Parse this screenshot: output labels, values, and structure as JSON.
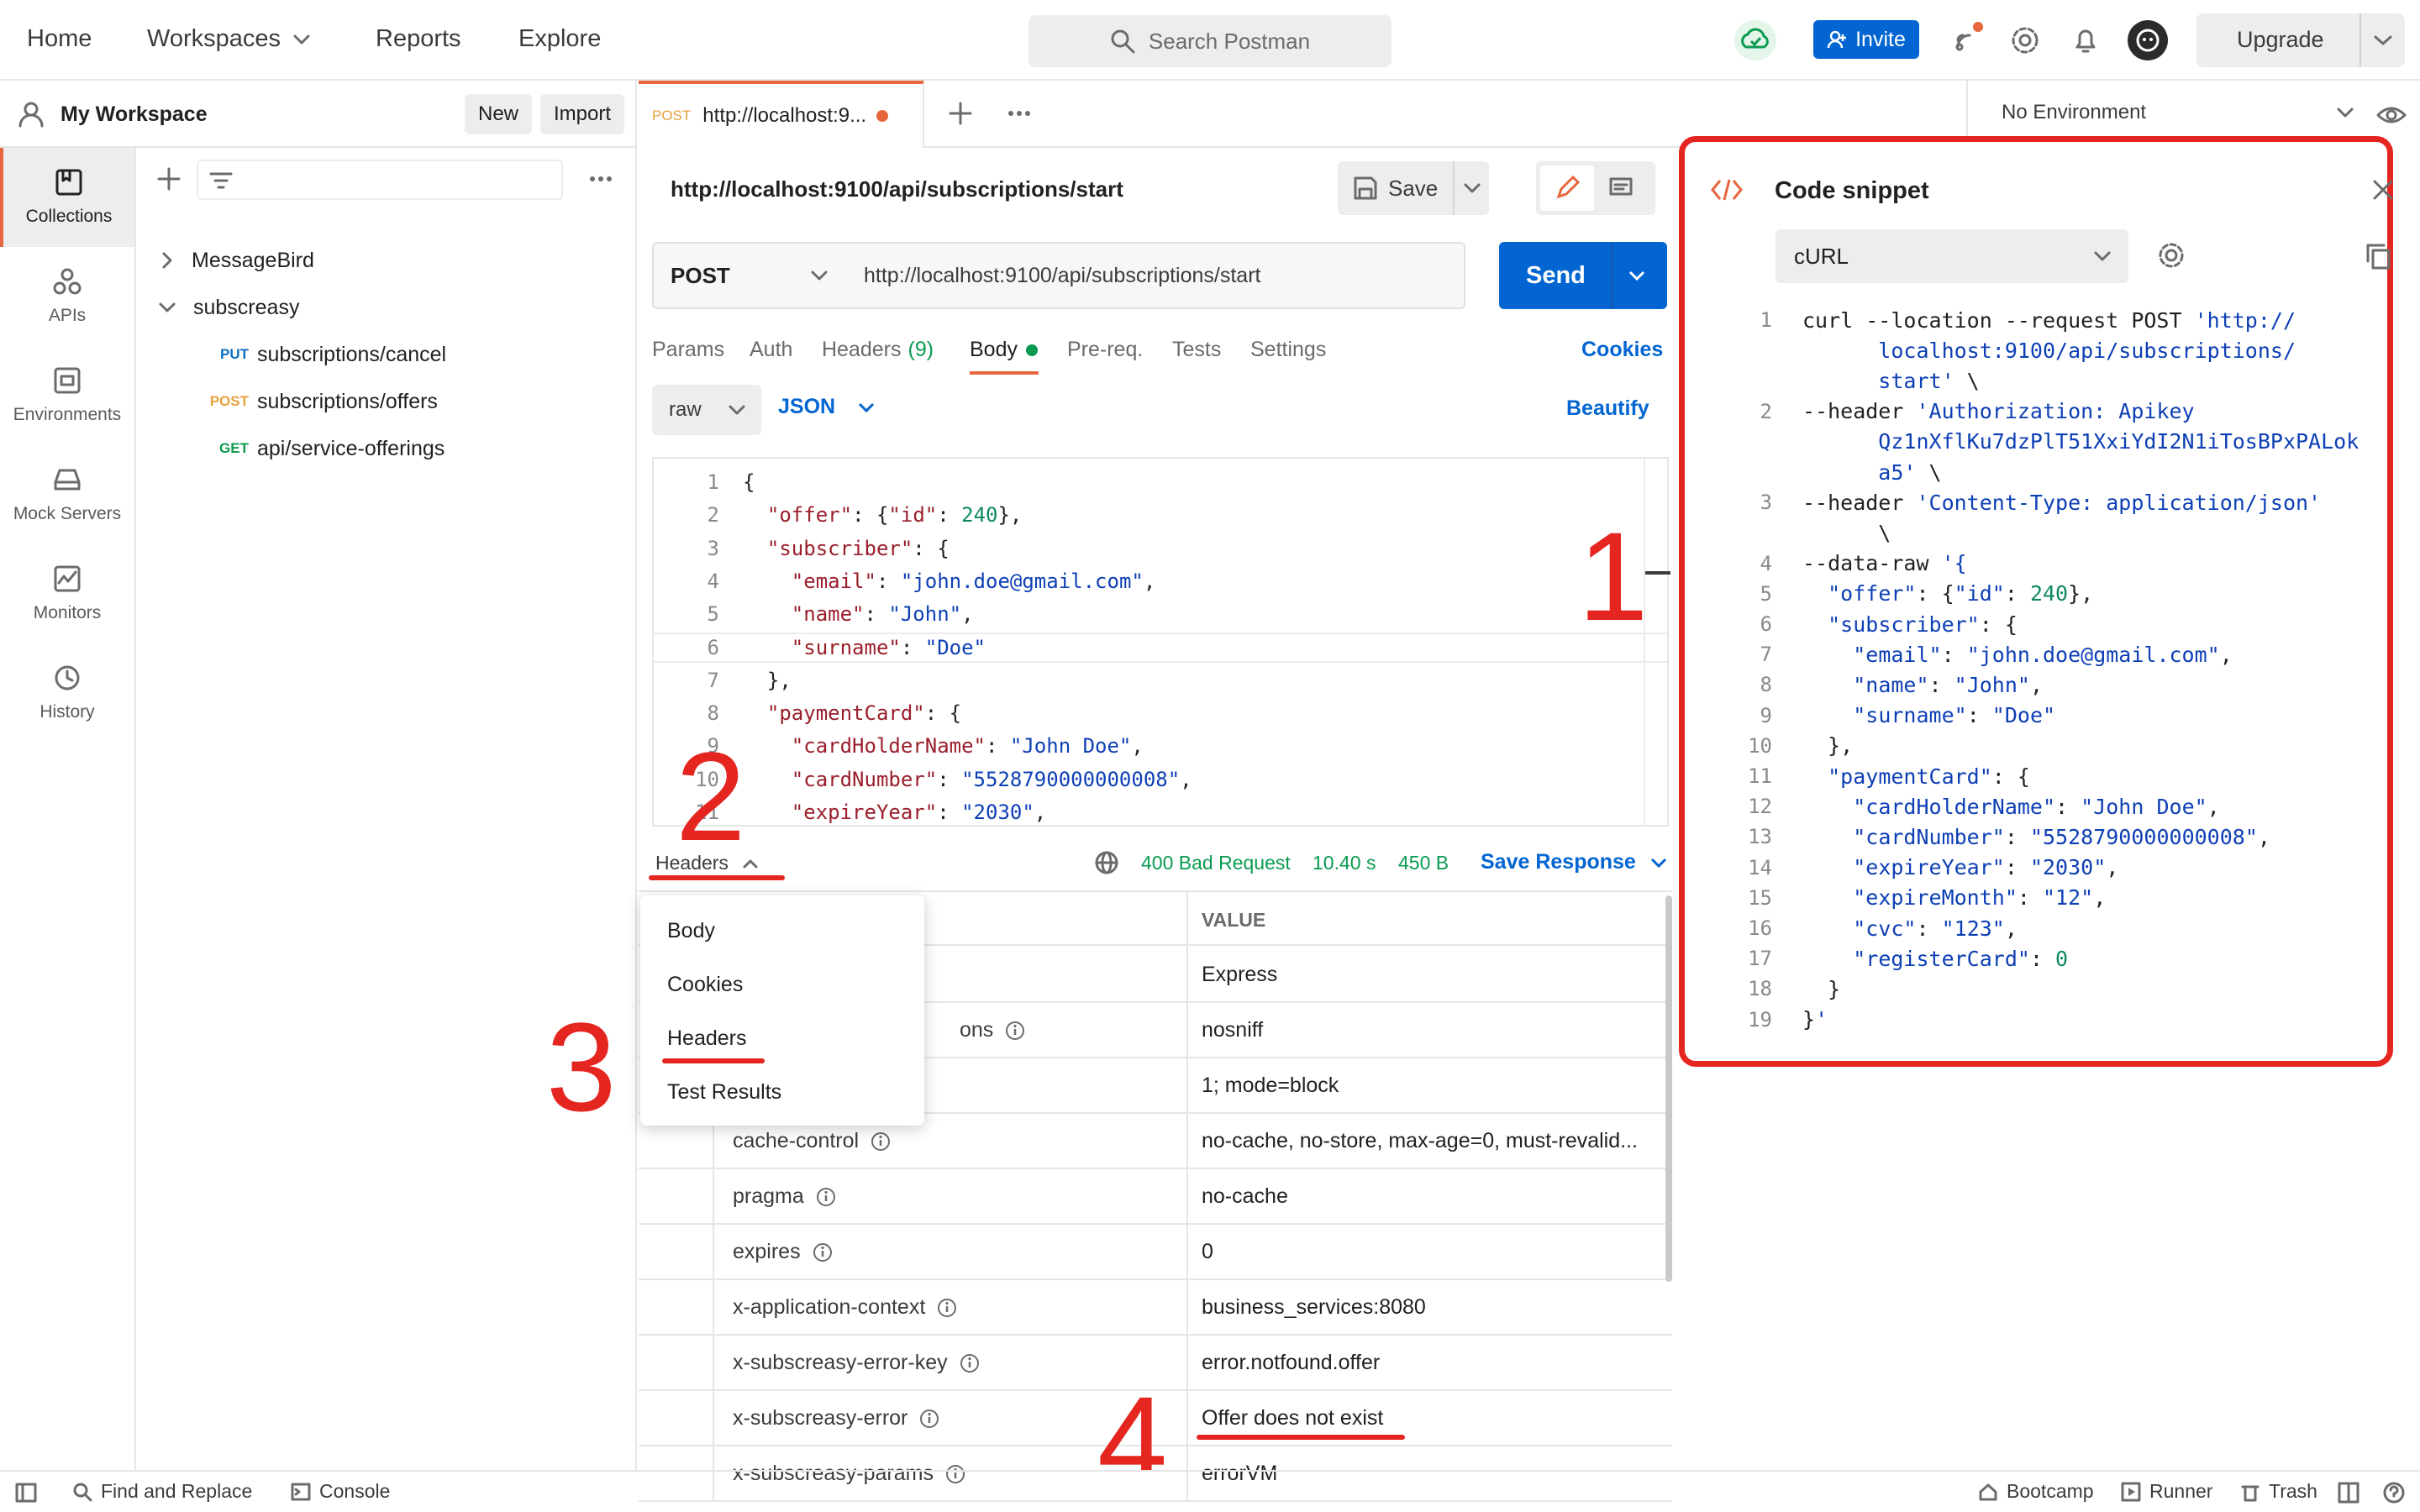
{
  "topnav": {
    "home": "Home",
    "workspaces": "Workspaces",
    "reports": "Reports",
    "explore": "Explore",
    "search_placeholder": "Search Postman",
    "invite": "Invite",
    "upgrade": "Upgrade"
  },
  "workspace": {
    "name": "My Workspace",
    "new": "New",
    "import": "Import"
  },
  "sidebar": [
    "Collections",
    "APIs",
    "Environments",
    "Mock Servers",
    "Monitors",
    "History"
  ],
  "tree": {
    "collections": [
      {
        "name": "MessageBird",
        "expanded": false
      },
      {
        "name": "subscreasy",
        "expanded": true
      }
    ],
    "requests": [
      {
        "method": "PUT",
        "path": "subscriptions/cancel",
        "color": "#0b6ec0"
      },
      {
        "method": "POST",
        "path": "subscriptions/offers",
        "color": "#e6a23c"
      },
      {
        "method": "GET",
        "path": "api/service-offerings",
        "color": "#0a9b50"
      }
    ]
  },
  "tab": {
    "method": "POST",
    "title": "http://localhost:9..."
  },
  "request": {
    "url_title": "http://localhost:9100/api/subscriptions/start",
    "save": "Save",
    "method": "POST",
    "url": "http://localhost:9100/api/subscriptions/start",
    "send": "Send",
    "tabs": {
      "params": "Params",
      "auth": "Auth",
      "headers": "Headers",
      "headers_count": "(9)",
      "body": "Body",
      "prereq": "Pre-req.",
      "tests": "Tests",
      "settings": "Settings"
    },
    "cookies": "Cookies",
    "body_mode": "raw",
    "body_lang": "JSON",
    "beautify": "Beautify"
  },
  "body_lines": [
    [
      [
        "p",
        "{"
      ]
    ],
    [
      [
        "p",
        "  "
      ],
      [
        "k",
        "\"offer\""
      ],
      [
        "p",
        ": {"
      ],
      [
        "k",
        "\"id\""
      ],
      [
        "p",
        ": "
      ],
      [
        "n",
        "240"
      ],
      [
        "p",
        "},"
      ]
    ],
    [
      [
        "p",
        "  "
      ],
      [
        "k",
        "\"subscriber\""
      ],
      [
        "p",
        ": {"
      ]
    ],
    [
      [
        "p",
        "    "
      ],
      [
        "k",
        "\"email\""
      ],
      [
        "p",
        ": "
      ],
      [
        "s",
        "\"john.doe@gmail.com\""
      ],
      [
        "p",
        ","
      ]
    ],
    [
      [
        "p",
        "    "
      ],
      [
        "k",
        "\"name\""
      ],
      [
        "p",
        ": "
      ],
      [
        "s",
        "\"John\""
      ],
      [
        "p",
        ","
      ]
    ],
    [
      [
        "p",
        "    "
      ],
      [
        "k",
        "\"surname\""
      ],
      [
        "p",
        ": "
      ],
      [
        "s",
        "\"Doe\""
      ]
    ],
    [
      [
        "p",
        "  },"
      ]
    ],
    [
      [
        "p",
        "  "
      ],
      [
        "k",
        "\"paymentCard\""
      ],
      [
        "p",
        ": {"
      ]
    ],
    [
      [
        "p",
        "    "
      ],
      [
        "k",
        "\"cardHolderName\""
      ],
      [
        "p",
        ": "
      ],
      [
        "s",
        "\"John Doe\""
      ],
      [
        "p",
        ","
      ]
    ],
    [
      [
        "p",
        "    "
      ],
      [
        "k",
        "\"cardNumber\""
      ],
      [
        "p",
        ": "
      ],
      [
        "s",
        "\"5528790000000008\""
      ],
      [
        "p",
        ","
      ]
    ],
    [
      [
        "p",
        "    "
      ],
      [
        "k",
        "\"expireYear\""
      ],
      [
        "p",
        ": "
      ],
      [
        "s",
        "\"2030\""
      ],
      [
        "p",
        ","
      ]
    ],
    [
      [
        "p",
        "    "
      ],
      [
        "k",
        "\"expireMonth\""
      ],
      [
        "p",
        ": "
      ],
      [
        "s",
        "\"12\""
      ],
      [
        "p",
        ","
      ]
    ]
  ],
  "response": {
    "view": "Headers",
    "status": "400 Bad Request",
    "time": "10.40 s",
    "size": "450 B",
    "save_response": "Save Response",
    "value_header": "VALUE"
  },
  "dropdown": [
    "Body",
    "Cookies",
    "Headers",
    "Test Results"
  ],
  "headers_rows": [
    {
      "key": "",
      "value": "Express"
    },
    {
      "key": "ons",
      "value": "nosniff"
    },
    {
      "key": "",
      "value": "1; mode=block"
    },
    {
      "key": "cache-control",
      "value": "no-cache, no-store, max-age=0, must-revalid..."
    },
    {
      "key": "pragma",
      "value": "no-cache"
    },
    {
      "key": "expires",
      "value": "0"
    },
    {
      "key": "x-application-context",
      "value": "business_services:8080"
    },
    {
      "key": "x-subscreasy-error-key",
      "value": "error.notfound.offer"
    },
    {
      "key": "x-subscreasy-error",
      "value": "Offer does not exist"
    },
    {
      "key": "x-subscreasy-params",
      "value": "errorVM"
    }
  ],
  "environment": "No Environment",
  "snippet": {
    "title": "Code snippet",
    "language": "cURL",
    "lines": [
      {
        "n": "1",
        "t": [
          [
            "p",
            "curl --location --request POST "
          ],
          [
            "s",
            "'http://"
          ]
        ]
      },
      {
        "n": "",
        "t": [
          [
            "s",
            "      localhost:9100/api/subscriptions/"
          ]
        ]
      },
      {
        "n": "",
        "t": [
          [
            "s",
            "      start'"
          ],
          [
            "p",
            " \\"
          ]
        ]
      },
      {
        "n": "2",
        "t": [
          [
            "p",
            "--header "
          ],
          [
            "s",
            "'Authorization: Apikey"
          ]
        ]
      },
      {
        "n": "",
        "t": [
          [
            "s",
            "      Qz1nXflKu7dzPlT51XxiYdI2N1iTosBPxPALok"
          ]
        ]
      },
      {
        "n": "",
        "t": [
          [
            "s",
            "      a5'"
          ],
          [
            "p",
            " \\"
          ]
        ]
      },
      {
        "n": "3",
        "t": [
          [
            "p",
            "--header "
          ],
          [
            "s",
            "'Content-Type: application/json'"
          ]
        ]
      },
      {
        "n": "",
        "t": [
          [
            "p",
            "      \\"
          ]
        ]
      },
      {
        "n": "4",
        "t": [
          [
            "p",
            "--data-raw "
          ],
          [
            "s",
            "'{"
          ]
        ]
      },
      {
        "n": "5",
        "t": [
          [
            "p",
            "  "
          ],
          [
            "s",
            "\"offer\""
          ],
          [
            "p",
            ": {"
          ],
          [
            "s",
            "\"id\""
          ],
          [
            "p",
            ": "
          ],
          [
            "n",
            "240"
          ],
          [
            "p",
            "},"
          ]
        ]
      },
      {
        "n": "6",
        "t": [
          [
            "p",
            "  "
          ],
          [
            "s",
            "\"subscriber\""
          ],
          [
            "p",
            ": {"
          ]
        ]
      },
      {
        "n": "7",
        "t": [
          [
            "p",
            "    "
          ],
          [
            "s",
            "\"email\""
          ],
          [
            "p",
            ": "
          ],
          [
            "s",
            "\"john.doe@gmail.com\""
          ],
          [
            "p",
            ","
          ]
        ]
      },
      {
        "n": "8",
        "t": [
          [
            "p",
            "    "
          ],
          [
            "s",
            "\"name\""
          ],
          [
            "p",
            ": "
          ],
          [
            "s",
            "\"John\""
          ],
          [
            "p",
            ","
          ]
        ]
      },
      {
        "n": "9",
        "t": [
          [
            "p",
            "    "
          ],
          [
            "s",
            "\"surname\""
          ],
          [
            "p",
            ": "
          ],
          [
            "s",
            "\"Doe\""
          ]
        ]
      },
      {
        "n": "10",
        "t": [
          [
            "p",
            "  },"
          ]
        ]
      },
      {
        "n": "11",
        "t": [
          [
            "p",
            "  "
          ],
          [
            "s",
            "\"paymentCard\""
          ],
          [
            "p",
            ": {"
          ]
        ]
      },
      {
        "n": "12",
        "t": [
          [
            "p",
            "    "
          ],
          [
            "s",
            "\"cardHolderName\""
          ],
          [
            "p",
            ": "
          ],
          [
            "s",
            "\"John Doe\""
          ],
          [
            "p",
            ","
          ]
        ]
      },
      {
        "n": "13",
        "t": [
          [
            "p",
            "    "
          ],
          [
            "s",
            "\"cardNumber\""
          ],
          [
            "p",
            ": "
          ],
          [
            "s",
            "\"5528790000000008\""
          ],
          [
            "p",
            ","
          ]
        ]
      },
      {
        "n": "14",
        "t": [
          [
            "p",
            "    "
          ],
          [
            "s",
            "\"expireYear\""
          ],
          [
            "p",
            ": "
          ],
          [
            "s",
            "\"2030\""
          ],
          [
            "p",
            ","
          ]
        ]
      },
      {
        "n": "15",
        "t": [
          [
            "p",
            "    "
          ],
          [
            "s",
            "\"expireMonth\""
          ],
          [
            "p",
            ": "
          ],
          [
            "s",
            "\"12\""
          ],
          [
            "p",
            ","
          ]
        ]
      },
      {
        "n": "16",
        "t": [
          [
            "p",
            "    "
          ],
          [
            "s",
            "\"cvc\""
          ],
          [
            "p",
            ": "
          ],
          [
            "s",
            "\"123\""
          ],
          [
            "p",
            ","
          ]
        ]
      },
      {
        "n": "17",
        "t": [
          [
            "p",
            "    "
          ],
          [
            "s",
            "\"registerCard\""
          ],
          [
            "p",
            ": "
          ],
          [
            "n",
            "0"
          ]
        ]
      },
      {
        "n": "18",
        "t": [
          [
            "p",
            "  }"
          ]
        ]
      },
      {
        "n": "19",
        "t": [
          [
            "p",
            "}"
          ],
          [
            "s",
            "'"
          ]
        ]
      }
    ]
  },
  "annotations": [
    "1",
    "2",
    "3",
    "4"
  ],
  "footer": {
    "find_replace": "Find and Replace",
    "console": "Console",
    "bootcamp": "Bootcamp",
    "runner": "Runner",
    "trash": "Trash"
  },
  "colors": {
    "accent": "#e8663d",
    "send": "#0265d2",
    "annotation": "#e52620",
    "status_ok": "#0a9b50"
  }
}
